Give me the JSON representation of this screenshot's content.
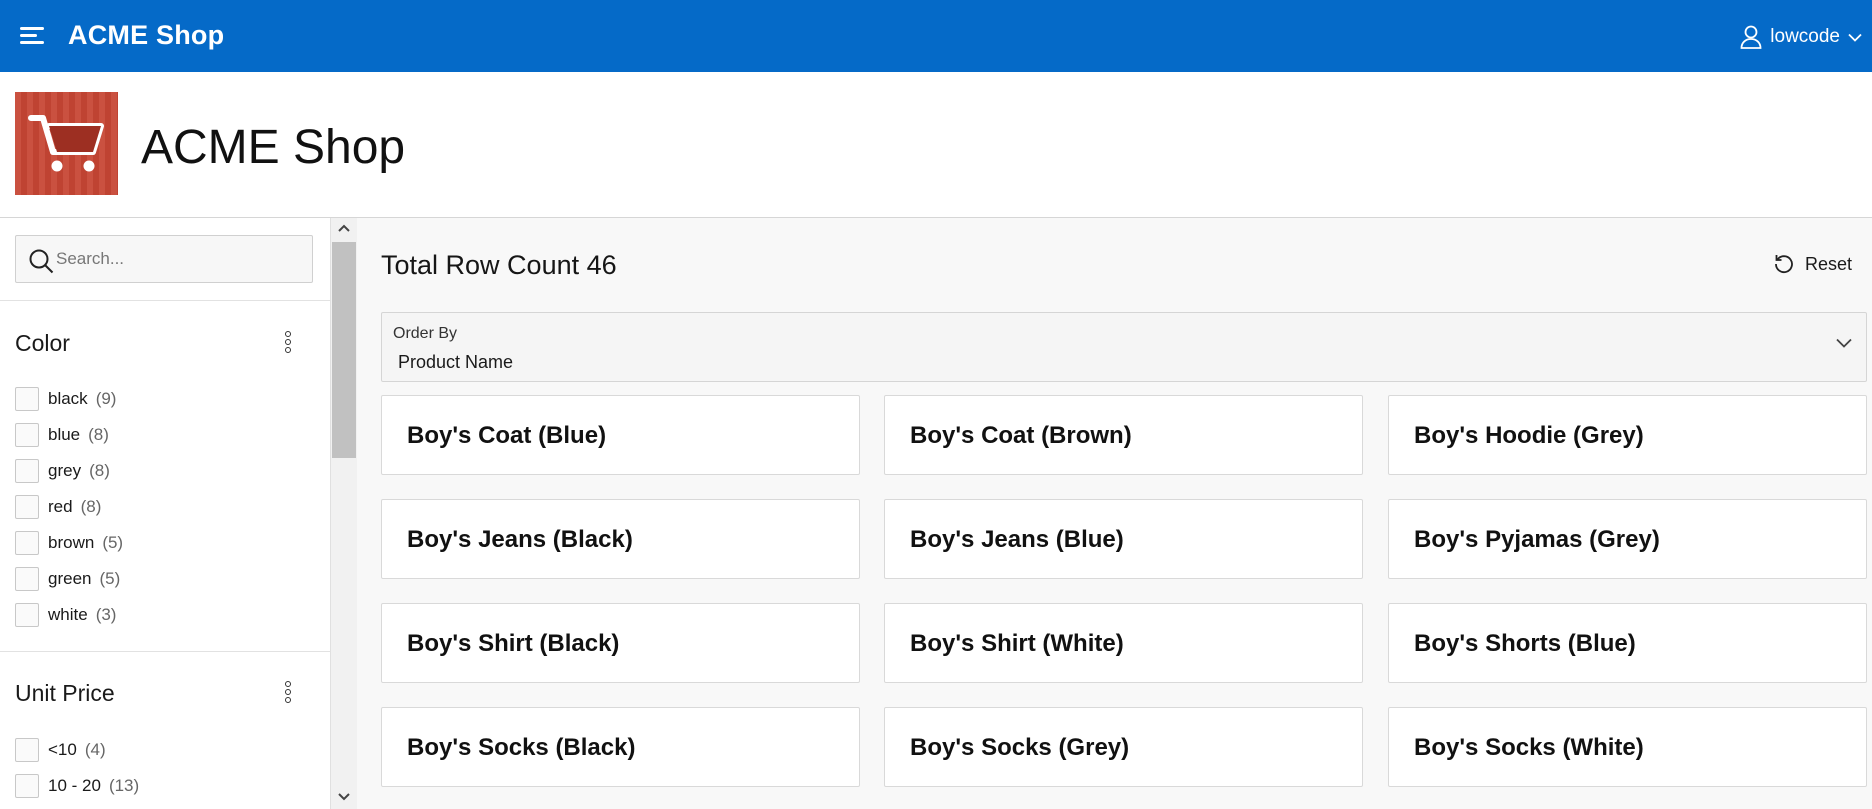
{
  "header": {
    "app_title": "ACME Shop",
    "username": "lowcode",
    "menu_icon": "hamburger-icon",
    "user_icon": "user-icon",
    "brand_color": "#056ac8"
  },
  "hero": {
    "title": "ACME Shop",
    "logo_icon": "shopping-cart-icon",
    "logo_color": "#c74634"
  },
  "search": {
    "placeholder": "Search..."
  },
  "facets": {
    "color": {
      "title": "Color",
      "options": [
        {
          "label": "black",
          "count": "(9)"
        },
        {
          "label": "blue",
          "count": "(8)"
        },
        {
          "label": "grey",
          "count": "(8)"
        },
        {
          "label": "red",
          "count": "(8)"
        },
        {
          "label": "brown",
          "count": "(5)"
        },
        {
          "label": "green",
          "count": "(5)"
        },
        {
          "label": "white",
          "count": "(3)"
        }
      ]
    },
    "unit_price": {
      "title": "Unit Price",
      "options": [
        {
          "label": "<10",
          "count": "(4)"
        },
        {
          "label": "10 - 20",
          "count": "(13)"
        }
      ]
    }
  },
  "results": {
    "total_label": "Total Row Count 46",
    "reset_label": "Reset",
    "order_by": {
      "label": "Order By",
      "value": "Product Name"
    },
    "products": [
      "Boy's Coat (Blue)",
      "Boy's Coat (Brown)",
      "Boy's Hoodie (Grey)",
      "Boy's Jeans (Black)",
      "Boy's Jeans (Blue)",
      "Boy's Pyjamas (Grey)",
      "Boy's Shirt (Black)",
      "Boy's Shirt (White)",
      "Boy's Shorts (Blue)",
      "Boy's Socks (Black)",
      "Boy's Socks (Grey)",
      "Boy's Socks (White)"
    ]
  }
}
